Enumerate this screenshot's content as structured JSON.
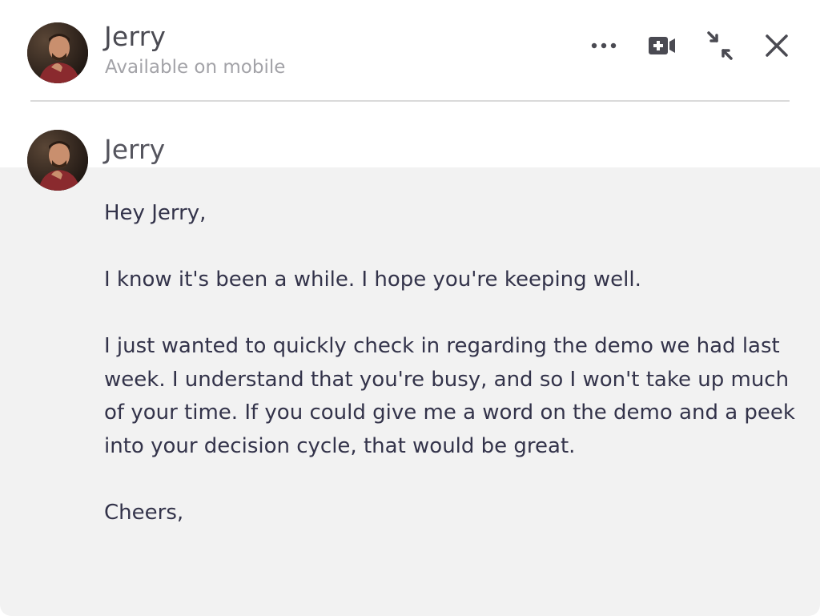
{
  "header": {
    "contact_name": "Jerry",
    "status": "Available on mobile",
    "actions": [
      {
        "icon": "more-horizontal-icon"
      },
      {
        "icon": "video-call-icon"
      },
      {
        "icon": "minimize-icon"
      },
      {
        "icon": "close-icon"
      }
    ]
  },
  "message": {
    "sender_name": "Jerry",
    "greeting": "Hey Jerry,",
    "paragraph_1": "I know it's been a while. I hope you're keeping well.",
    "paragraph_2": "I just wanted to quickly check in regarding the demo we had last week. I understand that you're busy, and so I won't take up much of your time. If you could give me a word on the demo and a peek into your decision cycle, that would be great.",
    "signoff": "Cheers,"
  },
  "colors": {
    "message_background": "#f2f2f2",
    "text": "#33334a",
    "status_text": "#a3a3a8"
  }
}
